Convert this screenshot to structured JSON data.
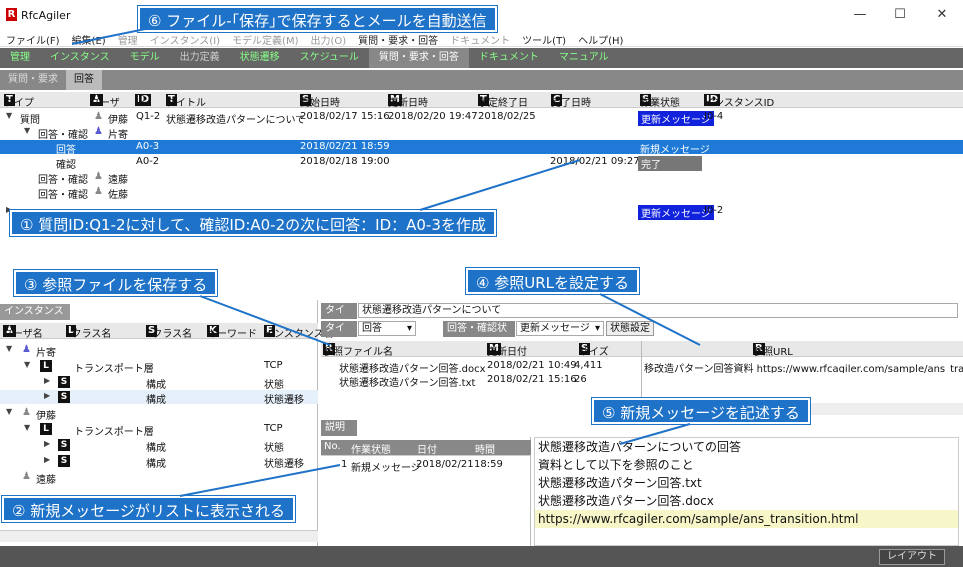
{
  "app": {
    "title": "RfcAgiler",
    "logo": "R"
  },
  "window_controls": {
    "minimize": "—",
    "maximize": "☐",
    "close": "✕"
  },
  "menu": [
    "ファイル(F)",
    "編集(E)",
    "管理",
    "インスタンス(I)",
    "モデル定義(M)",
    "出力(O)",
    "質問・要求・回答",
    "ドキュメント",
    "ツール(T)",
    "ヘルプ(H)"
  ],
  "modes": [
    "管理",
    "インスタンス",
    "モデル",
    "出力定義",
    "状態遷移",
    "スケジュール",
    "質問・要求・回答",
    "ドキュメント",
    "マニュアル"
  ],
  "active_mode": "質問・要求・回答",
  "subtabs": [
    "質問・要求",
    "回答"
  ],
  "grid": {
    "headers": {
      "type": "タイプ",
      "user": "ユーザ",
      "id": "ID",
      "title": "タイトル",
      "start": "開始日時",
      "updated": "更新日時",
      "due": "予定終了日",
      "done": "完了日時",
      "status": "作業状態",
      "instance": "インスタンスID"
    },
    "rows": [
      {
        "type": "質問",
        "user": "伊藤",
        "id": "Q1-2",
        "title": "状態遷移改造パターンについて",
        "start": "2018/02/17 15:16",
        "updated": "2018/02/20 19:47",
        "due": "2018/02/25",
        "done": "",
        "status": "更新メッセージ",
        "instance": "I0-4"
      },
      {
        "type": "回答・確認",
        "user": "片寄",
        "id": "",
        "title": "",
        "start": "",
        "updated": "",
        "due": "",
        "done": "",
        "status": "",
        "instance": ""
      },
      {
        "type": "回答",
        "user": "",
        "id": "A0-3",
        "title": "",
        "start": "2018/02/21 18:59",
        "updated": "",
        "due": "",
        "done": "",
        "status": "新規メッセージ",
        "instance": ""
      },
      {
        "type": "確認",
        "user": "",
        "id": "A0-2",
        "title": "",
        "start": "2018/02/18 19:00",
        "updated": "",
        "due": "",
        "done": "2018/02/21 09:27",
        "status": "完了",
        "instance": ""
      },
      {
        "type": "回答・確認",
        "user": "遠藤",
        "id": "",
        "title": "",
        "start": "",
        "updated": "",
        "due": "",
        "done": "",
        "status": "",
        "instance": ""
      },
      {
        "type": "回答・確認",
        "user": "佐藤",
        "id": "",
        "title": "",
        "start": "",
        "updated": "",
        "due": "",
        "done": "",
        "status": "",
        "instance": ""
      },
      {
        "type": "",
        "user": "",
        "id": "",
        "title": "",
        "start": "",
        "updated": "",
        "due": "",
        "done": "",
        "status": "更新メッセージ",
        "instance": "I0-2"
      }
    ]
  },
  "callouts": {
    "c1": "① 質問ID:Q1-2に対して、確認ID:A0-2の次に回答：ID：A0-3を作成",
    "c2": "② 新規メッセージがリストに表示される",
    "c3": "③ 参照ファイルを保存する",
    "c4": "④ 参照URLを設定する",
    "c5": "⑤ 新規メッセージを記述する",
    "c6": "⑥ ファイル-｢保存｣で保存するとメールを自動送信"
  },
  "instance_pane": {
    "tab": "インスタンス",
    "headers": {
      "user": "ユーザ名",
      "lclass": "Lクラス名",
      "sclass": "Sクラス名",
      "keyword": "キーワード",
      "instance": "インスタンス名"
    },
    "tree": [
      {
        "level": 0,
        "user": "片寄"
      },
      {
        "level": 1,
        "lclass": "トランスポート層",
        "kw": "TCP"
      },
      {
        "level": 2,
        "sclass": "構成",
        "kw": "状態"
      },
      {
        "level": 2,
        "sclass": "構成",
        "kw": "状態遷移"
      },
      {
        "level": 0,
        "user": "伊藤"
      },
      {
        "level": 1,
        "lclass": "トランスポート層",
        "kw": "TCP"
      },
      {
        "level": 2,
        "sclass": "構成",
        "kw": "状態"
      },
      {
        "level": 2,
        "sclass": "構成",
        "kw": "状態遷移"
      },
      {
        "level": 0,
        "user": "遠藤"
      }
    ]
  },
  "detail": {
    "title_label": "タイトル",
    "title_value": "状態遷移改造パターンについて",
    "type_label": "タイプ",
    "type_value": "回答",
    "state_label": "回答・確認状態",
    "state_value": "更新メッセージ",
    "state_button": "状態設定",
    "files_headers": {
      "file": "参照ファイル名",
      "updated": "更新日付",
      "size": "サイズ"
    },
    "files": [
      {
        "name": "状態遷移改造パターン回答.docx",
        "updated": "2018/02/21 10:49",
        "size": "4,411"
      },
      {
        "name": "状態遷移改造パターン回答.txt",
        "updated": "2018/02/21 15:16",
        "size": "26"
      }
    ],
    "url_header": "参照URL",
    "url_value": "移改造パターン回答資料 https://www.rfcagiler.com/sample/ans_transi"
  },
  "description": {
    "tab": "説明",
    "list_headers": {
      "no": "No.",
      "state": "作業状態",
      "date": "日付",
      "time": "時間"
    },
    "list": [
      {
        "no": "1",
        "state": "新規メッセージ",
        "date": "2018/02/21",
        "time": "18:59"
      }
    ],
    "text_lines": [
      "状態遷移改造パターンについての回答",
      "資料として以下を参照のこと",
      "状態遷移改造パターン回答.txt",
      "状態遷移改造パターン回答.docx",
      "https://www.rfcagiler.com/sample/ans_transition.html"
    ]
  },
  "statusbar": {
    "layout_button": "レイアウト"
  }
}
